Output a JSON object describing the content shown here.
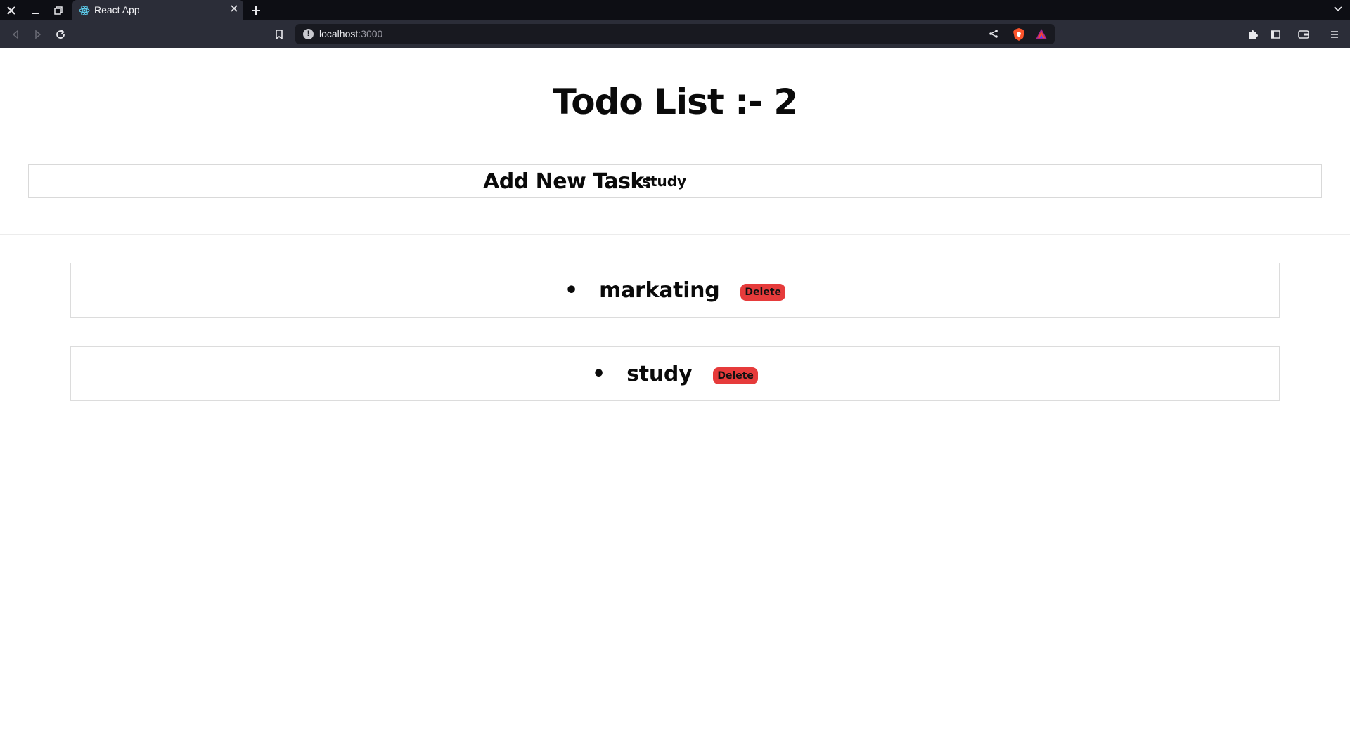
{
  "browser": {
    "tab_title": "React App",
    "url_host": "localhost",
    "url_port": ":3000"
  },
  "app": {
    "title": "Todo List :-  2",
    "add_label": "Add New Task:",
    "input_value": "study",
    "todos": [
      {
        "text": "markating",
        "delete_label": "Delete"
      },
      {
        "text": "study",
        "delete_label": "Delete"
      }
    ],
    "delete_color": "#e63b3b"
  }
}
